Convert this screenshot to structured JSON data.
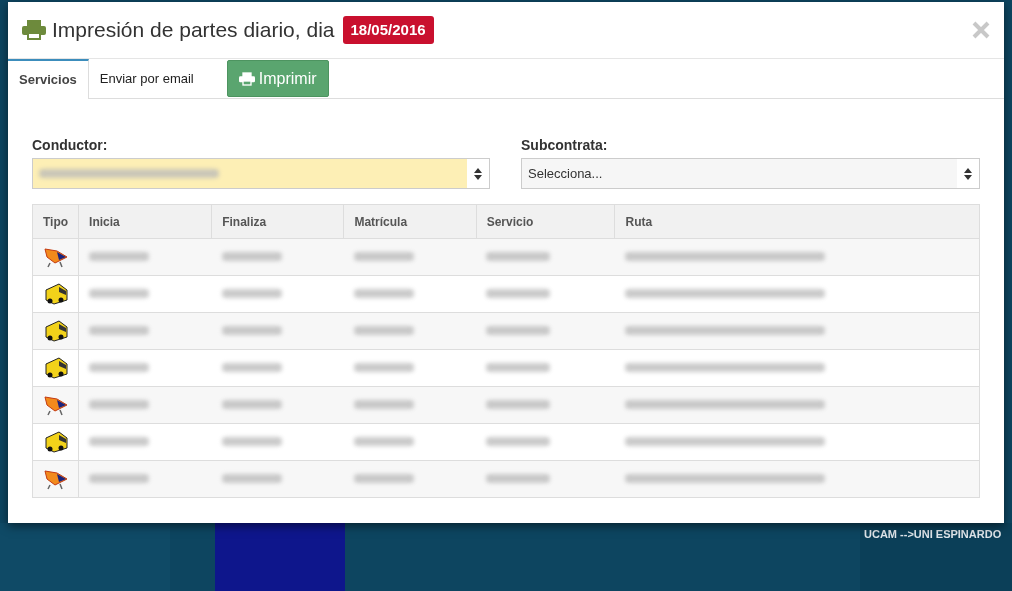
{
  "modal": {
    "title": "Impresión de partes diario, dia",
    "date_badge": "18/05/2016"
  },
  "tabs": [
    {
      "label": "Servicios",
      "selected": true
    },
    {
      "label": "Enviar por email",
      "selected": false
    }
  ],
  "print_button": "Imprimir",
  "conductor": {
    "label": "Conductor:",
    "highlighted": true
  },
  "subcontrata": {
    "label": "Subcontrata:",
    "value": "Selecciona...",
    "highlighted": false
  },
  "table": {
    "columns": [
      "Tipo",
      "Inicia",
      "Finaliza",
      "Matrícula",
      "Servicio",
      "Ruta"
    ],
    "rows": [
      {
        "kind": "glider"
      },
      {
        "kind": "bus"
      },
      {
        "kind": "bus"
      },
      {
        "kind": "bus"
      },
      {
        "kind": "glider"
      },
      {
        "kind": "bus"
      },
      {
        "kind": "glider"
      }
    ]
  },
  "background": {
    "route_label": "UCAM -->UNI ESPINARDO"
  }
}
